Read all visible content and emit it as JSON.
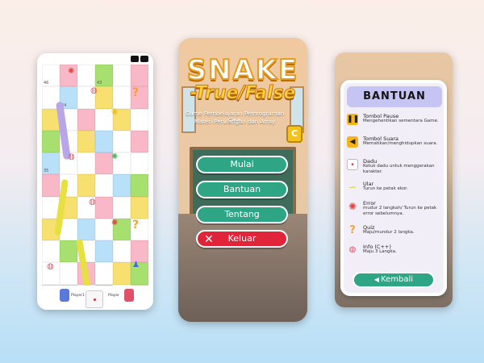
{
  "board": {
    "cells": [
      {
        "num": "46",
        "color": "#ffffff"
      },
      {
        "num": "",
        "color": "#f8b8c8"
      },
      {
        "num": "",
        "color": "#ffffff"
      },
      {
        "num": "43",
        "color": "#a8e070"
      },
      {
        "num": "",
        "color": "#ffffff"
      },
      {
        "num": "",
        "color": "#f8b8c8"
      },
      {
        "num": "",
        "color": "#ffffff"
      },
      {
        "num": "44",
        "color": "#b8e0f8"
      },
      {
        "num": "",
        "color": "#ffffff"
      },
      {
        "num": "",
        "color": "#f8e070"
      },
      {
        "num": "",
        "color": "#ffffff"
      },
      {
        "num": "",
        "color": "#f8b8c8"
      },
      {
        "num": "",
        "color": "#f8e070"
      },
      {
        "num": "",
        "color": "#ffffff"
      },
      {
        "num": "",
        "color": "#f8b8c8"
      },
      {
        "num": "",
        "color": "#ffffff"
      },
      {
        "num": "",
        "color": "#f8e070"
      },
      {
        "num": "",
        "color": "#ffffff"
      },
      {
        "num": "",
        "color": "#a8e070"
      },
      {
        "num": "",
        "color": "#ffffff"
      },
      {
        "num": "",
        "color": "#f8e070"
      },
      {
        "num": "",
        "color": "#b8e0f8"
      },
      {
        "num": "",
        "color": "#ffffff"
      },
      {
        "num": "",
        "color": "#f8b8c8"
      },
      {
        "num": "35",
        "color": "#b8e0f8"
      },
      {
        "num": "",
        "color": "#ffffff"
      },
      {
        "num": "",
        "color": "#ffffff"
      },
      {
        "num": "",
        "color": "#f8b8c8"
      },
      {
        "num": "",
        "color": "#ffffff"
      },
      {
        "num": "",
        "color": "#ffffff"
      },
      {
        "num": "",
        "color": "#f8b8c8"
      },
      {
        "num": "",
        "color": "#ffffff"
      },
      {
        "num": "",
        "color": "#f8e070"
      },
      {
        "num": "",
        "color": "#ffffff"
      },
      {
        "num": "",
        "color": "#b8e0f8"
      },
      {
        "num": "",
        "color": "#a8e070"
      },
      {
        "num": "",
        "color": "#ffffff"
      },
      {
        "num": "",
        "color": "#f8e070"
      },
      {
        "num": "",
        "color": "#ffffff"
      },
      {
        "num": "",
        "color": "#f8b8c8"
      },
      {
        "num": "",
        "color": "#ffffff"
      },
      {
        "num": "",
        "color": "#f8e070"
      },
      {
        "num": "",
        "color": "#f8e070"
      },
      {
        "num": "",
        "color": "#ffffff"
      },
      {
        "num": "",
        "color": "#b8e0f8"
      },
      {
        "num": "",
        "color": "#ffffff"
      },
      {
        "num": "",
        "color": "#a8e070"
      },
      {
        "num": "",
        "color": "#ffffff"
      },
      {
        "num": "",
        "color": "#ffffff"
      },
      {
        "num": "",
        "color": "#a8e070"
      },
      {
        "num": "",
        "color": "#ffffff"
      },
      {
        "num": "",
        "color": "#b8e0f8"
      },
      {
        "num": "",
        "color": "#ffffff"
      },
      {
        "num": "",
        "color": "#f8b8c8"
      },
      {
        "num": "",
        "color": "#ffffff"
      },
      {
        "num": "",
        "color": "#ffffff"
      },
      {
        "num": "",
        "color": "#f8b8c8"
      },
      {
        "num": "",
        "color": "#ffffff"
      },
      {
        "num": "",
        "color": "#f8e070"
      },
      {
        "num": "",
        "color": "#a8e070"
      },
      {
        "num": "",
        "color": "#f8e070"
      },
      {
        "num": "",
        "color": "#b8e0f8"
      },
      {
        "num": "",
        "color": "#ffffff"
      },
      {
        "num": "",
        "color": "#a8e070"
      },
      {
        "num": "",
        "color": "#ffffff"
      },
      {
        "num": "",
        "color": "#b8e0f8"
      }
    ],
    "player1_label": "Player1",
    "player2_label": "Player",
    "colors": {
      "snake": "#b8a6e8",
      "snake_yellow": "#e8e040",
      "error": "#e04848",
      "dice_dot": "#e03030"
    }
  },
  "menu": {
    "title_line1": "SNAKE",
    "title_line2": "-True/False",
    "subtitle_line1": "Game Pembelajaran Pemrograman C++",
    "subtitle_line2": "Materi Perulangan dan Array",
    "cpp_badge": "C",
    "buttons": [
      {
        "label": "Mulai",
        "color": "#2ea585"
      },
      {
        "label": "Bantuan",
        "color": "#2ea585"
      },
      {
        "label": "Tentang",
        "color": "#2ea585"
      },
      {
        "label": "Keluar",
        "color": "#e0243a"
      }
    ]
  },
  "help": {
    "title": "BANTUAN",
    "items": [
      {
        "title": "Tombol Pause",
        "desc": "Mengehentikan sementara Game.",
        "icon": "pause-icon"
      },
      {
        "title": "Tombol Suara",
        "desc": "Mematikan/menghidupkan suara.",
        "icon": "speaker-icon"
      },
      {
        "title": "Dadu",
        "desc": "Ketuk dadu untuk menggerakan karakter.",
        "icon": "dice-icon"
      },
      {
        "title": "Ular",
        "desc": "Turun ke petak ekor.",
        "icon": "snake-icon"
      },
      {
        "title": "Error",
        "desc": "mudur 2 langkah/ Turun ke petak error sebelumnya.",
        "icon": "error-icon"
      },
      {
        "title": "Quiz",
        "desc": "Maju/mundur 2 langka.",
        "icon": "quiz-icon"
      },
      {
        "title": "Info (C++)",
        "desc": "Maju 3 Langka.",
        "icon": "info-cpp-icon"
      }
    ],
    "back_label": "Kembali"
  }
}
